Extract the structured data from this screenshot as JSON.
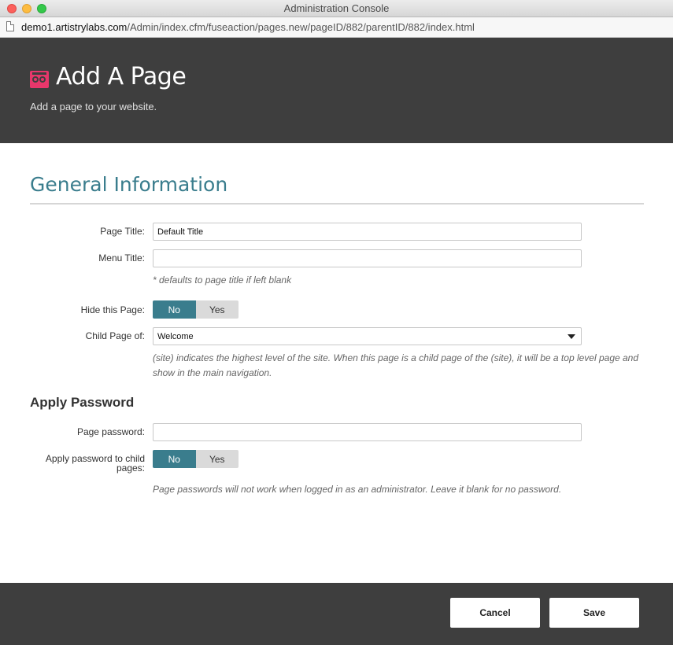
{
  "window": {
    "title": "Administration Console",
    "url_host": "demo1.artistrylabs.com",
    "url_path": "/Admin/index.cfm/fuseaction/pages.new/pageID/882/parentID/882/index.html"
  },
  "header": {
    "title": "Add A Page",
    "subtitle": "Add a page to your website.",
    "brand_color": "#e8376b",
    "background": "#3e3e3e"
  },
  "general": {
    "section_title": "General Information",
    "page_title_label": "Page Title:",
    "page_title_value": "Default Title",
    "menu_title_label": "Menu Title:",
    "menu_title_value": "",
    "menu_title_hint": "* defaults to page title if left blank",
    "hide_label": "Hide this Page:",
    "hide_options": {
      "no": "No",
      "yes": "Yes",
      "selected": "No"
    },
    "child_label": "Child Page of:",
    "child_value": "Welcome",
    "child_hint": "(site) indicates the highest level of the site. When this page is a child page of the (site), it will be a top level page and show in the main navigation."
  },
  "password": {
    "section_title": "Apply Password",
    "page_password_label": "Page password:",
    "page_password_value": "",
    "apply_child_label": "Apply password to child pages:",
    "apply_child_options": {
      "no": "No",
      "yes": "Yes",
      "selected": "No"
    },
    "hint": "Page passwords will not work when logged in as an administrator. Leave it blank for no password."
  },
  "footer": {
    "cancel_label": "Cancel",
    "save_label": "Save"
  },
  "colors": {
    "accent": "#3a7d8d",
    "toggle_off": "#dadada"
  }
}
